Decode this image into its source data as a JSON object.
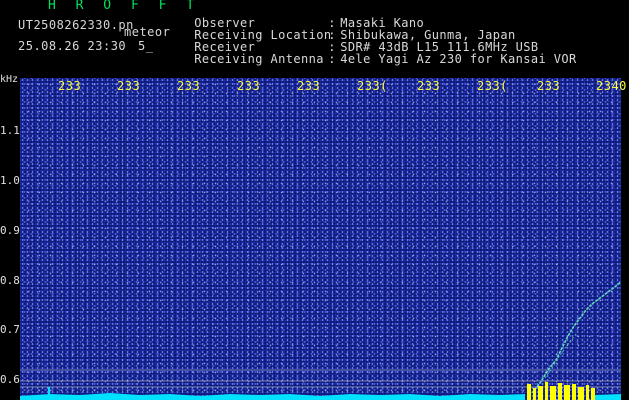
{
  "header": {
    "app_title": "H R O F F T",
    "file_name": "UT2508262330.pn",
    "meteor_label": "meteor",
    "date_time": "25.08.26 23:30",
    "count": "5_"
  },
  "info": [
    {
      "key": "Observer",
      "sep": ":",
      "value": "Masaki Kano"
    },
    {
      "key": "Receiving Location",
      "sep": ":",
      "value": "Shibukawa, Gunma, Japan"
    },
    {
      "key": "Receiver",
      "sep": ":",
      "value": "SDR# 43dB L15 111.6MHz USB"
    },
    {
      "key": "Receiving Antenna",
      "sep": ":",
      "value": "4ele Yagi Az 230 for Kansai VOR"
    }
  ],
  "y_axis": {
    "unit": "kHz",
    "ticks": [
      "1.1",
      "1.0",
      "0.9",
      "0.8",
      "0.7",
      "0.6"
    ]
  },
  "x_axis": {
    "ticks": [
      "233",
      "233",
      "233",
      "233",
      "233",
      "233(",
      "233",
      "233(",
      "233",
      "2340"
    ]
  },
  "colors": {
    "background": "#0c1266",
    "scale_text": "#ffff40",
    "title": "#00e060",
    "noise_floor": "#00e0ff",
    "signal": "#ffff00",
    "meteor_trace": "#60d8c0"
  }
}
